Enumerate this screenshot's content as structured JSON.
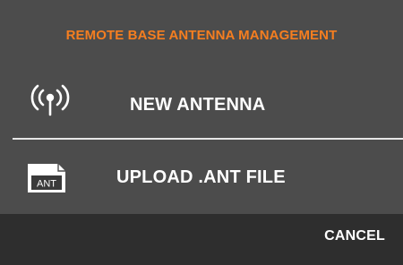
{
  "dialog": {
    "title": "REMOTE BASE ANTENNA MANAGEMENT",
    "accent_color": "#f57e20",
    "options": [
      {
        "label": "NEW ANTENNA",
        "icon": "antenna-signal-icon"
      },
      {
        "label": "UPLOAD .ANT FILE",
        "icon": "ant-file-icon",
        "icon_text": "ANT"
      }
    ],
    "cancel_label": "CANCEL"
  }
}
